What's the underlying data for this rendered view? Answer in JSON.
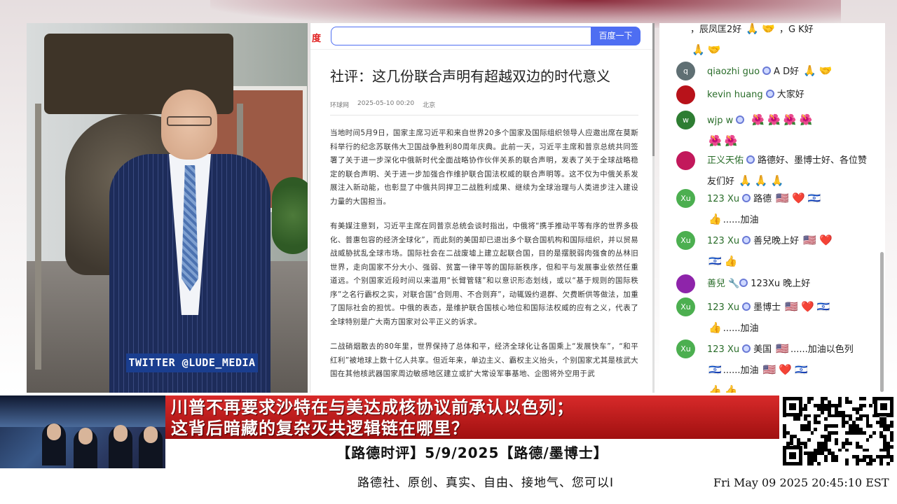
{
  "colors": {
    "headline_bg": "#c41d1d",
    "twitter_bg": "#1a3e8f",
    "search_button": "#4e6ef2",
    "username_green": "#2a6d2a"
  },
  "video": {
    "twitter_tag": "TWITTER @LUDE_MEDIA"
  },
  "browser": {
    "logo_text": "度",
    "search_button": "百度一下",
    "article": {
      "title": "社评：这几份联合声明有超越双边的时代意义",
      "source": "环球网",
      "datetime": "2025-05-10 00:20",
      "location": "北京",
      "paragraphs": [
        "当地时间5月9日，国家主席习近平和来自世界20多个国家及国际组织领导人应邀出席在莫斯科举行的纪念苏联伟大卫国战争胜利80周年庆典。此前一天，习近平主席和普京总统共同签署了关于进一步深化中俄新时代全面战略协作伙伴关系的联合声明，发表了关于全球战略稳定的联合声明、关于进一步加强合作维护联合国法权威的联合声明等。这不仅为中俄关系发展注入新动能，也彰显了中俄共同捍卫二战胜利成果、继续为全球治理与人类进步注入建设力量的大国担当。",
        "有美媒注意到，习近平主席在同普京总统会谈时指出，中俄将“携手推动平等有序的世界多极化、普惠包容的经济全球化”，而此刻的美国却已退出多个联合国机构和国际组织，并以贸易战威胁扰乱全球市场。国际社会在二战废墟上建立起联合国，目的是摆脱弱肉强食的丛林旧世界，走向国家不分大小、强弱、贫富一律平等的国际新秩序，但和平与发展事业依然任重道远。个别国家近段时间以来滥用“长臂管辖”和以意识形态划线，或以“基于规则的国际秩序”之名行霸权之实，对联合国“合则用、不合则弃”，动辄毁约退群、欠费断供等做法，加重了国际社会的担忧。中俄的表态，是维护联合国核心地位和国际法权威的应有之义，代表了全球特别是广大南方国家对公平正义的诉求。",
        "二战硝烟散去的80年里，世界保持了总体和平，经济全球化让各国乘上“发展快车”，“和平红利”被地球上数十亿人共享。但近年来，单边主义、霸权主义抬头，个别国家尤其是核武大国在其他核武器国家周边敏感地区建立或扩大常设军事基地、企图将外空用于武"
      ]
    }
  },
  "chat": {
    "messages": [
      {
        "user": "",
        "text": "，辰凤匡2好",
        "emojis": [
          "🙏",
          "🤝"
        ],
        "tail": "，G K好",
        "emojis2": [
          "🙏",
          "🤝"
        ],
        "avatar": "",
        "avatar_color": "#ffffff"
      },
      {
        "user": "qiaozhi guo",
        "text": "A D好",
        "emojis": [
          "🙏",
          "🤝"
        ],
        "tail": "",
        "emojis2": [],
        "avatar": "q",
        "avatar_color": "#5f6f73"
      },
      {
        "user": "kevin huang",
        "text": "大家好",
        "emojis": [],
        "tail": "",
        "emojis2": [],
        "avatar": "",
        "avatar_color": "#b8121a"
      },
      {
        "user": "wjp w",
        "text": "",
        "emojis": [
          "🌺",
          "🌺",
          "🌺",
          "🌺",
          "🌺",
          "🌺"
        ],
        "tail": "",
        "emojis2": [],
        "avatar": "w",
        "avatar_color": "#2e7d32"
      },
      {
        "user": "正义天佑",
        "text": "路德好、墨博士好、各位赞友们好",
        "emojis": [
          "🙏",
          "🙏",
          "🙏"
        ],
        "tail": "",
        "emojis2": [],
        "avatar": "",
        "avatar_color": "#c2185b"
      },
      {
        "user": "123 Xu",
        "text": "路德",
        "emojis": [
          "🇺🇸",
          "❤️",
          "🇮🇱",
          "👍"
        ],
        "tail": "......加油",
        "emojis2": [],
        "avatar": "Xu",
        "avatar_color": "#4caf50"
      },
      {
        "user": "123 Xu",
        "text": "善兒晚上好",
        "emojis": [
          "🇺🇸",
          "❤️",
          "🇮🇱",
          "👍"
        ],
        "tail": "",
        "emojis2": [],
        "avatar": "Xu",
        "avatar_color": "#4caf50"
      },
      {
        "user": "善兒",
        "text": "123Xu 晚上好",
        "emojis": [],
        "tail": "",
        "emojis2": [],
        "avatar": "",
        "avatar_color": "#8e24aa"
      },
      {
        "user": "123 Xu",
        "text": "墨博士",
        "emojis": [
          "🇺🇸",
          "❤️",
          "🇮🇱",
          "👍"
        ],
        "tail": "......加油",
        "emojis2": [],
        "avatar": "Xu",
        "avatar_color": "#4caf50"
      },
      {
        "user": "123 Xu",
        "text": "美国",
        "emojis": [
          "🇺🇸"
        ],
        "tail": "......加油以色列",
        "emojis2": [
          "🇮🇱"
        ],
        "tail2": "......加油",
        "emojis3": [
          "🇺🇸",
          "❤️",
          "🇮🇱",
          "👍",
          "👍"
        ],
        "avatar": "Xu",
        "avatar_color": "#4caf50"
      }
    ]
  },
  "banner": {
    "headline_line1": "川普不再要求沙特在与美达成核协议前承认以色列；",
    "headline_line2": "这背后暗藏的复杂灭共逻辑链在哪里？",
    "subtitle": "【路德时评】5/9/2025【路德/墨博士】",
    "slogan": "路德社、原创、真实、自由、接地气、您可以I",
    "timestamp": "Fri May 09 2025 20:45:10 EST"
  }
}
